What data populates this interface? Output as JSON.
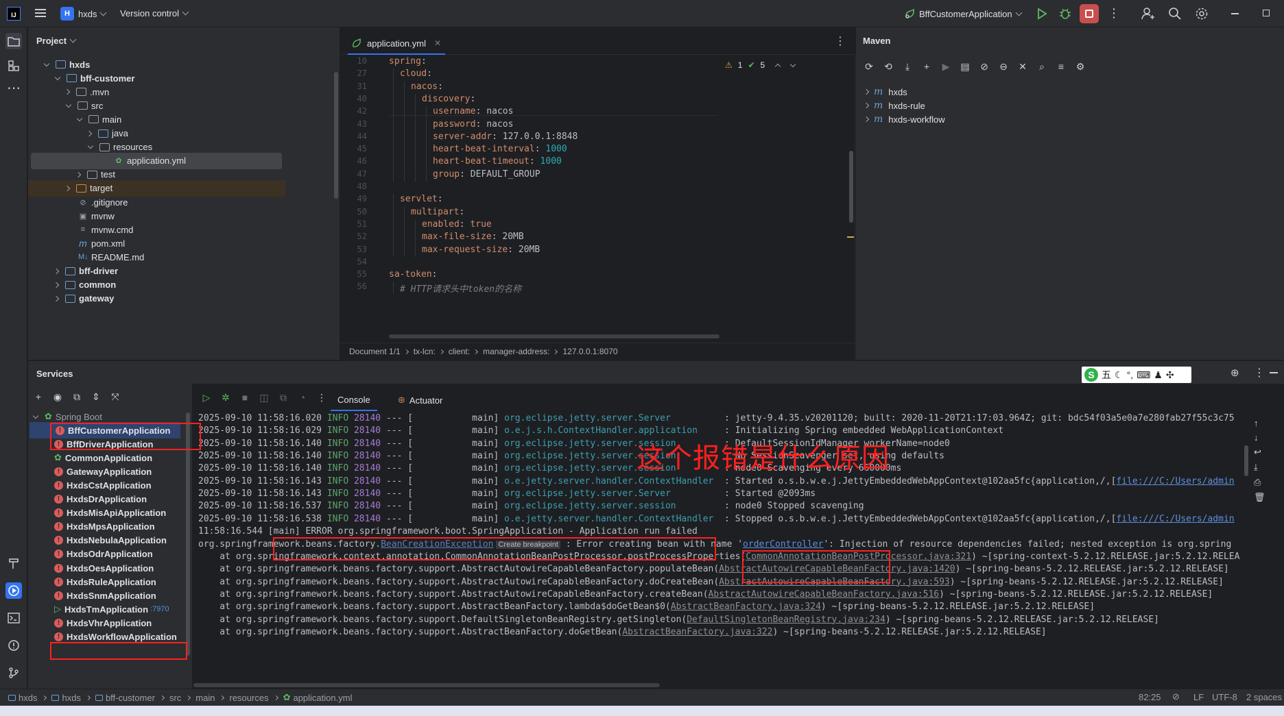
{
  "titlebar": {
    "logo": "IJ",
    "project_badge": "H",
    "project_name": "hxds",
    "vcs_label": "Version control",
    "run_config": "BffCustomerApplication",
    "icons": [
      "menu-icon",
      "run-icon",
      "debug-icon",
      "stop-icon",
      "more-icon",
      "add-user-icon",
      "search-icon",
      "settings-icon",
      "minimize-icon",
      "maximize-icon"
    ]
  },
  "project": {
    "title": "Project",
    "tree": [
      {
        "label": "hxds",
        "kind": "folder-blue",
        "depth": 1,
        "open": true,
        "bold": true
      },
      {
        "label": "bff-customer",
        "kind": "folder-blue",
        "depth": 2,
        "open": true,
        "bold": true
      },
      {
        "label": ".mvn",
        "kind": "folder",
        "depth": 3,
        "open": false
      },
      {
        "label": "src",
        "kind": "folder",
        "depth": 3,
        "open": true
      },
      {
        "label": "main",
        "kind": "folder",
        "depth": 4,
        "open": true
      },
      {
        "label": "java",
        "kind": "folder-blue",
        "depth": 5,
        "open": false
      },
      {
        "label": "resources",
        "kind": "folder",
        "depth": 5,
        "open": true
      },
      {
        "label": "application.yml",
        "kind": "yml",
        "depth": 6,
        "selected": true
      },
      {
        "label": "test",
        "kind": "folder",
        "depth": 4,
        "open": false
      },
      {
        "label": "target",
        "kind": "folder-orange",
        "depth": 3,
        "open": false,
        "highlight": true
      },
      {
        "label": ".gitignore",
        "kind": "ignore",
        "depth": 3
      },
      {
        "label": "mvnw",
        "kind": "term",
        "depth": 3
      },
      {
        "label": "mvnw.cmd",
        "kind": "lines",
        "depth": 3
      },
      {
        "label": "pom.xml",
        "kind": "maven",
        "depth": 3
      },
      {
        "label": "README.md",
        "kind": "md",
        "depth": 3
      },
      {
        "label": "bff-driver",
        "kind": "folder-blue",
        "depth": 2,
        "open": false,
        "bold": true
      },
      {
        "label": "common",
        "kind": "folder-blue",
        "depth": 2,
        "open": false,
        "bold": true
      },
      {
        "label": "gateway",
        "kind": "folder-blue",
        "depth": 2,
        "open": false,
        "bold": true
      }
    ]
  },
  "editor": {
    "tab_label": "application.yml",
    "inspection": {
      "warnings": "1",
      "ok": "5"
    },
    "lines": [
      {
        "num": "10",
        "parts": [
          [
            "k",
            "spring"
          ],
          [
            "v",
            ":"
          ]
        ],
        "indent": 0
      },
      {
        "num": "27",
        "parts": [
          [
            "k",
            "cloud"
          ],
          [
            "v",
            ":"
          ]
        ],
        "indent": 1
      },
      {
        "num": "31",
        "parts": [
          [
            "k",
            "nacos"
          ],
          [
            "v",
            ":"
          ]
        ],
        "indent": 2
      },
      {
        "num": "40",
        "parts": [
          [
            "k",
            "discovery"
          ],
          [
            "v",
            ":"
          ]
        ],
        "indent": 3
      },
      {
        "num": "42",
        "parts": [
          [
            "k",
            "username"
          ],
          [
            "v",
            ": nacos"
          ]
        ],
        "indent": 4
      },
      {
        "num": "43",
        "parts": [
          [
            "k",
            "password"
          ],
          [
            "v",
            ": nacos"
          ]
        ],
        "indent": 4
      },
      {
        "num": "44",
        "parts": [
          [
            "k",
            "server-addr"
          ],
          [
            "v",
            ": 127.0.0.1:8848"
          ]
        ],
        "indent": 4
      },
      {
        "num": "45",
        "parts": [
          [
            "k",
            "heart-beat-interval"
          ],
          [
            "v",
            ": "
          ],
          [
            "n",
            "1000"
          ]
        ],
        "indent": 4
      },
      {
        "num": "46",
        "parts": [
          [
            "k",
            "heart-beat-timeout"
          ],
          [
            "v",
            ": "
          ],
          [
            "n",
            "1000"
          ]
        ],
        "indent": 4
      },
      {
        "num": "47",
        "parts": [
          [
            "k",
            "group"
          ],
          [
            "v",
            ": DEFAULT_GROUP"
          ]
        ],
        "indent": 4
      },
      {
        "num": "48",
        "parts": [],
        "indent": 0
      },
      {
        "num": "49",
        "parts": [
          [
            "k",
            "servlet"
          ],
          [
            "v",
            ":"
          ]
        ],
        "indent": 1
      },
      {
        "num": "50",
        "parts": [
          [
            "k",
            "multipart"
          ],
          [
            "v",
            ":"
          ]
        ],
        "indent": 2
      },
      {
        "num": "51",
        "parts": [
          [
            "k",
            "enabled"
          ],
          [
            "v",
            ": "
          ],
          [
            "k",
            "true"
          ]
        ],
        "indent": 3
      },
      {
        "num": "52",
        "parts": [
          [
            "k",
            "max-file-size"
          ],
          [
            "v",
            ": 20MB"
          ]
        ],
        "indent": 3
      },
      {
        "num": "53",
        "parts": [
          [
            "k",
            "max-request-size"
          ],
          [
            "v",
            ": 20MB"
          ]
        ],
        "indent": 3
      },
      {
        "num": "54",
        "parts": [],
        "indent": 0
      },
      {
        "num": "55",
        "parts": [
          [
            "k",
            "sa-token"
          ],
          [
            "v",
            ":"
          ]
        ],
        "indent": 0
      },
      {
        "num": "56",
        "parts": [
          [
            "cmt",
            "# HTTP请求头中token的名称"
          ]
        ],
        "indent": 1
      }
    ],
    "breadcrumb": [
      "Document 1/1",
      "tx-lcn:",
      "client:",
      "manager-address:",
      "127.0.0.1:8070"
    ]
  },
  "maven": {
    "title": "Maven",
    "projects": [
      "hxds",
      "hxds-rule",
      "hxds-workflow"
    ]
  },
  "services": {
    "title": "Services",
    "tabs": [
      "Console",
      "Actuator"
    ],
    "group_label": "Spring Boot",
    "apps": [
      {
        "name": "BffCustomerApplication",
        "status": "error",
        "selected": true
      },
      {
        "name": "BffDriverApplication",
        "status": "error"
      },
      {
        "name": "CommonApplication",
        "status": "config"
      },
      {
        "name": "GatewayApplication",
        "status": "error"
      },
      {
        "name": "HxdsCstApplication",
        "status": "error"
      },
      {
        "name": "HxdsDrApplication",
        "status": "error"
      },
      {
        "name": "HxdsMisApiApplication",
        "status": "error"
      },
      {
        "name": "HxdsMpsApplication",
        "status": "error"
      },
      {
        "name": "HxdsNebulaApplication",
        "status": "error"
      },
      {
        "name": "HxdsOdrApplication",
        "status": "error"
      },
      {
        "name": "HxdsOesApplication",
        "status": "error"
      },
      {
        "name": "HxdsRuleApplication",
        "status": "error"
      },
      {
        "name": "HxdsSnmApplication",
        "status": "error"
      },
      {
        "name": "HxdsTmApplication",
        "status": "running",
        "port": ":7970"
      },
      {
        "name": "HxdsVhrApplication",
        "status": "error"
      },
      {
        "name": "HxdsWorkflowApplication",
        "status": "error"
      }
    ]
  },
  "console": {
    "lines": [
      {
        "ts": "2025-09-10 11:58:16.020",
        "lvl": "INFO",
        "pid": "28140",
        "th": "main",
        "log": "org.eclipse.jetty.server.Server",
        "msg": ": jetty-9.4.35.v20201120; built: 2020-11-20T21:17:03.964Z; git: bdc54f03a5e0a7e280fab27f55c3c75"
      },
      {
        "ts": "2025-09-10 11:58:16.029",
        "lvl": "INFO",
        "pid": "28140",
        "th": "main",
        "log": "o.e.j.s.h.ContextHandler.application",
        "msg": ": Initializing Spring embedded WebApplicationContext"
      },
      {
        "ts": "2025-09-10 11:58:16.140",
        "lvl": "INFO",
        "pid": "28140",
        "th": "main",
        "log": "org.eclipse.jetty.server.session",
        "msg": ": DefaultSessionIdManager workerName=node0"
      },
      {
        "ts": "2025-09-10 11:58:16.140",
        "lvl": "INFO",
        "pid": "28140",
        "th": "main",
        "log": "org.eclipse.jetty.server.session",
        "msg": ": No SessionScavenger set, using defaults"
      },
      {
        "ts": "2025-09-10 11:58:16.140",
        "lvl": "INFO",
        "pid": "28140",
        "th": "main",
        "log": "org.eclipse.jetty.server.session",
        "msg": ": node0 Scavenging every 660000ms"
      },
      {
        "ts": "2025-09-10 11:58:16.143",
        "lvl": "INFO",
        "pid": "28140",
        "th": "main",
        "log": "o.e.jetty.server.handler.ContextHandler",
        "msg": ": Started o.s.b.w.e.j.JettyEmbeddedWebAppContext@102aa5fc{application,/,[",
        "link": "file:///C:/Users/admin"
      },
      {
        "ts": "2025-09-10 11:58:16.143",
        "lvl": "INFO",
        "pid": "28140",
        "th": "main",
        "log": "org.eclipse.jetty.server.Server",
        "msg": ": Started @2093ms"
      },
      {
        "ts": "2025-09-10 11:58:16.537",
        "lvl": "INFO",
        "pid": "28140",
        "th": "main",
        "log": "org.eclipse.jetty.server.session",
        "msg": ": node0 Stopped scavenging"
      },
      {
        "ts": "2025-09-10 11:58:16.538",
        "lvl": "INFO",
        "pid": "28140",
        "th": "main",
        "log": "o.e.jetty.server.handler.ContextHandler",
        "msg": ": Stopped o.s.b.w.e.j.JettyEmbeddedWebAppContext@102aa5fc{application,/,[",
        "link": "file:///C:/Users/admin"
      }
    ],
    "error_line": "11:58:16.544 [main] ERROR org.springframework.boot.SpringApplication - Application run failed",
    "exception_prefix": "org.springframework.beans.factory.",
    "exception_class": "BeanCreationException",
    "create_breakpoint": "Create breakpoint",
    "exception_msg_a": " : Error creating bean with name '",
    "exception_bean": "orderController",
    "exception_msg_b": "': Injection of resource dependencies failed; nested exception is org.spring",
    "stack": [
      {
        "pre": "    at org.springframework.context.annotation.CommonAnnotationBeanPostProcessor.postProcessProperties(",
        "link": "CommonAnnotationBeanPostProcessor.java:321",
        "post": ") ~[spring-context-5.2.12.RELEASE.jar:5.2.12.RELEA"
      },
      {
        "pre": "    at org.springframework.beans.factory.support.AbstractAutowireCapableBeanFactory.populateBean(",
        "link": "AbstractAutowireCapableBeanFactory.java:1420",
        "post": ") ~[spring-beans-5.2.12.RELEASE.jar:5.2.12.RELEASE]"
      },
      {
        "pre": "    at org.springframework.beans.factory.support.AbstractAutowireCapableBeanFactory.doCreateBean(",
        "link": "AbstractAutowireCapableBeanFactory.java:593",
        "post": ") ~[spring-beans-5.2.12.RELEASE.jar:5.2.12.RELEASE]"
      },
      {
        "pre": "    at org.springframework.beans.factory.support.AbstractAutowireCapableBeanFactory.createBean(",
        "link": "AbstractAutowireCapableBeanFactory.java:516",
        "post": ") ~[spring-beans-5.2.12.RELEASE.jar:5.2.12.RELEASE]"
      },
      {
        "pre": "    at org.springframework.beans.factory.support.AbstractBeanFactory.lambda$doGetBean$0(",
        "link": "AbstractBeanFactory.java:324",
        "post": ") ~[spring-beans-5.2.12.RELEASE.jar:5.2.12.RELEASE]"
      },
      {
        "pre": "    at org.springframework.beans.factory.support.DefaultSingletonBeanRegistry.getSingleton(",
        "link": "DefaultSingletonBeanRegistry.java:234",
        "post": ") ~[spring-beans-5.2.12.RELEASE.jar:5.2.12.RELEASE]"
      },
      {
        "pre": "    at org.springframework.beans.factory.support.AbstractBeanFactory.doGetBean(",
        "link": "AbstractBeanFactory.java:322",
        "post": ") ~[spring-beans-5.2.12.RELEASE.jar:5.2.12.RELEASE]"
      }
    ]
  },
  "annotation": {
    "text": "这个报错是什么原因",
    "color": "#ff2020"
  },
  "ime": {
    "label": "五"
  },
  "statusbar": {
    "path": [
      "hxds",
      "hxds",
      "bff-customer",
      "src",
      "main",
      "resources",
      "application.yml"
    ],
    "position": "82:25",
    "line_sep": "LF",
    "encoding": "UTF-8",
    "indent": "2 spaces"
  },
  "colors": {
    "accent": "#3574f0",
    "error": "#db5c5c",
    "run": "#5fb865",
    "annotation": "#ff2020"
  }
}
